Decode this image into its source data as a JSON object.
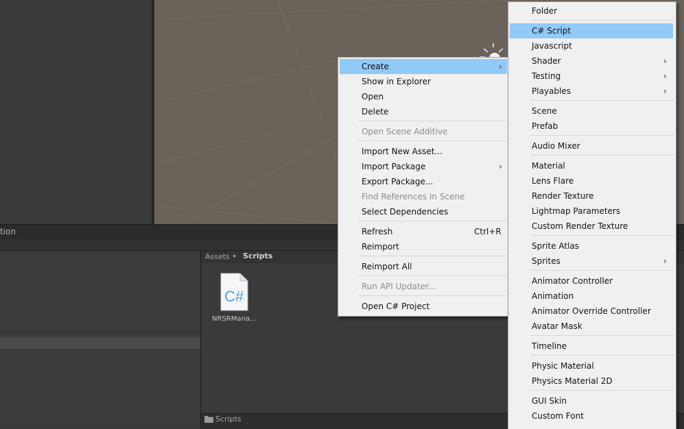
{
  "panels": {
    "tab_label": "tion",
    "breadcrumb": {
      "root": "Assets",
      "arrow": "▸",
      "current": "Scripts"
    },
    "asset": {
      "icon_text": "C#",
      "name": "NRSRMana..."
    },
    "status_path": "Scripts"
  },
  "context_menu": {
    "create": {
      "label": "Create",
      "arrow": "›"
    },
    "show_in_explorer": "Show in Explorer",
    "open": "Open",
    "delete": "Delete",
    "open_scene_additive": "Open Scene Additive",
    "import_new_asset": "Import New Asset...",
    "import_package": {
      "label": "Import Package",
      "arrow": "›"
    },
    "export_package": "Export Package...",
    "find_references": "Find References In Scene",
    "select_dependencies": "Select Dependencies",
    "refresh": {
      "label": "Refresh",
      "shortcut": "Ctrl+R"
    },
    "reimport": "Reimport",
    "reimport_all": "Reimport All",
    "run_api_updater": "Run API Updater...",
    "open_csharp_project": "Open C# Project"
  },
  "create_submenu": {
    "folder": "Folder",
    "csharp_script": "C# Script",
    "javascript": "Javascript",
    "shader": {
      "label": "Shader",
      "arrow": "›"
    },
    "testing": {
      "label": "Testing",
      "arrow": "›"
    },
    "playables": {
      "label": "Playables",
      "arrow": "›"
    },
    "scene": "Scene",
    "prefab": "Prefab",
    "audio_mixer": "Audio Mixer",
    "material": "Material",
    "lens_flare": "Lens Flare",
    "render_texture": "Render Texture",
    "lightmap_parameters": "Lightmap Parameters",
    "custom_render_texture": "Custom Render Texture",
    "sprite_atlas": "Sprite Atlas",
    "sprites": {
      "label": "Sprites",
      "arrow": "›"
    },
    "animator_controller": "Animator Controller",
    "animation": "Animation",
    "animator_override_controller": "Animator Override Controller",
    "avatar_mask": "Avatar Mask",
    "timeline": "Timeline",
    "physic_material": "Physic Material",
    "physics_material_2d": "Physics Material 2D",
    "gui_skin": "GUI Skin",
    "custom_font": "Custom Font"
  },
  "colors": {
    "menu_background": "#f0f0f0",
    "menu_highlight": "#91c9f7",
    "disabled_text": "#8d8d8d",
    "scene_background": "#6b6359",
    "editor_dark": "#383838"
  }
}
